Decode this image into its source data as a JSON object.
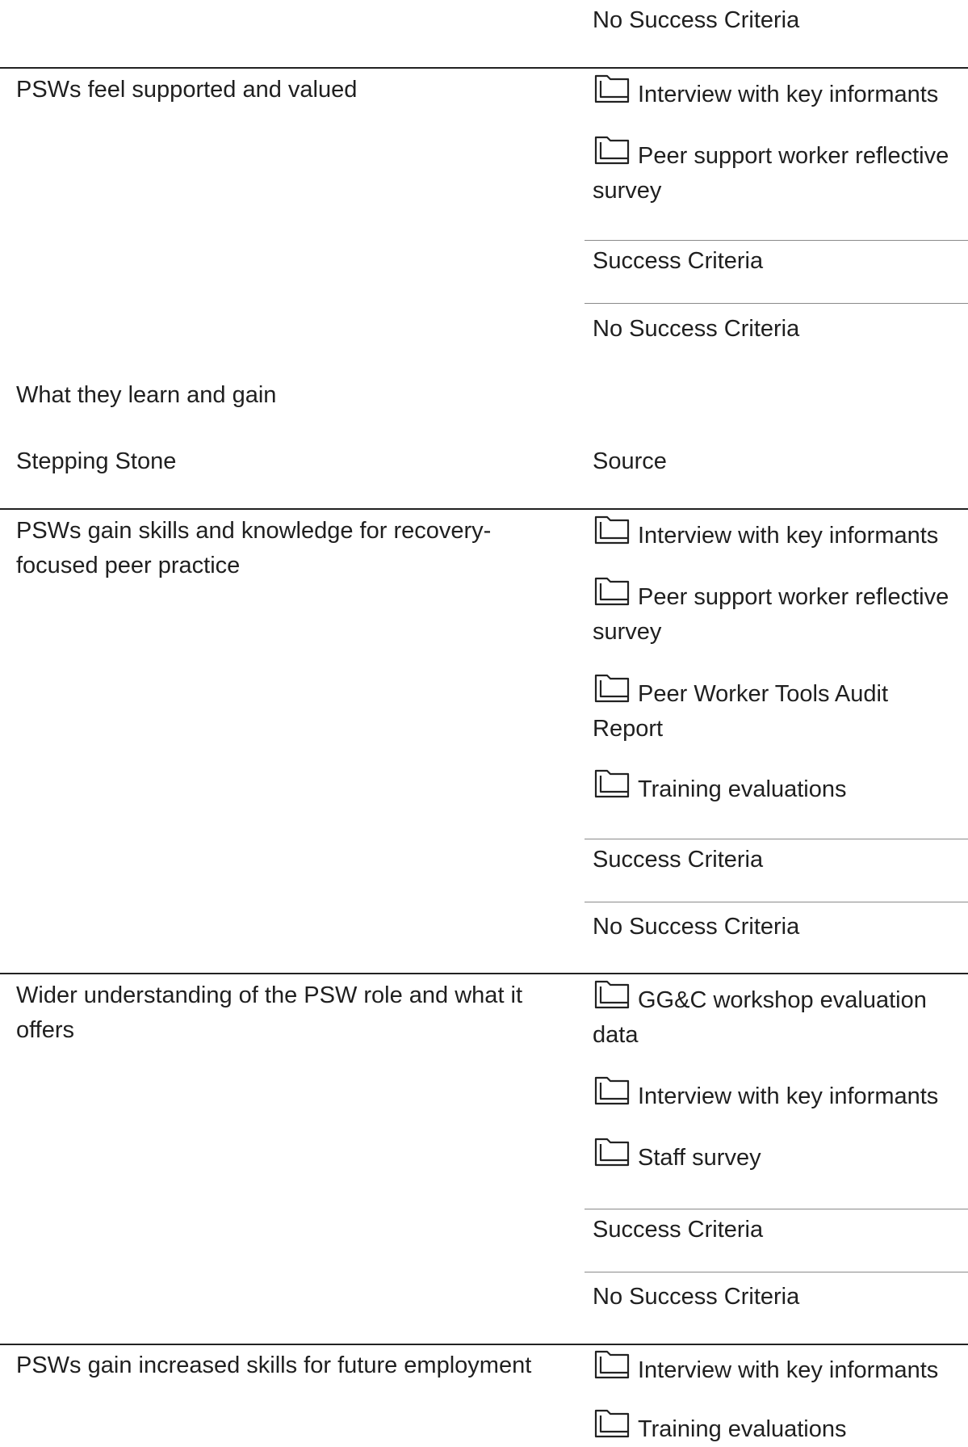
{
  "top_block": {
    "no_success_criteria": "No Success Criteria"
  },
  "rows": [
    {
      "stepping_stone": "PSWs feel supported and valued",
      "sources": [
        "Interview with key informants",
        "Peer support worker reflective survey"
      ],
      "success_criteria_label": "Success Criteria",
      "no_success_criteria": "No Success Criteria"
    }
  ],
  "section": {
    "title": "What they learn and gain",
    "col_stepping_stone": "Stepping Stone",
    "col_source": "Source"
  },
  "rows2": [
    {
      "stepping_stone": "PSWs gain skills and knowledge for recovery-focused peer practice",
      "sources": [
        "Interview with key informants",
        "Peer support worker reflective survey",
        "Peer Worker Tools Audit Report",
        "Training evaluations"
      ],
      "success_criteria_label": "Success Criteria",
      "no_success_criteria": "No Success Criteria"
    },
    {
      "stepping_stone": "Wider understanding of the PSW role and what it offers",
      "sources": [
        "GG&C workshop evaluation data",
        "Interview with key informants",
        "Staff survey"
      ],
      "success_criteria_label": "Success Criteria",
      "no_success_criteria": "No Success Criteria"
    },
    {
      "stepping_stone": "PSWs gain increased skills for future employment",
      "sources": [
        "Interview with key informants",
        "Training evaluations"
      ]
    }
  ],
  "icons": {
    "source_icon": "folder-icon"
  }
}
